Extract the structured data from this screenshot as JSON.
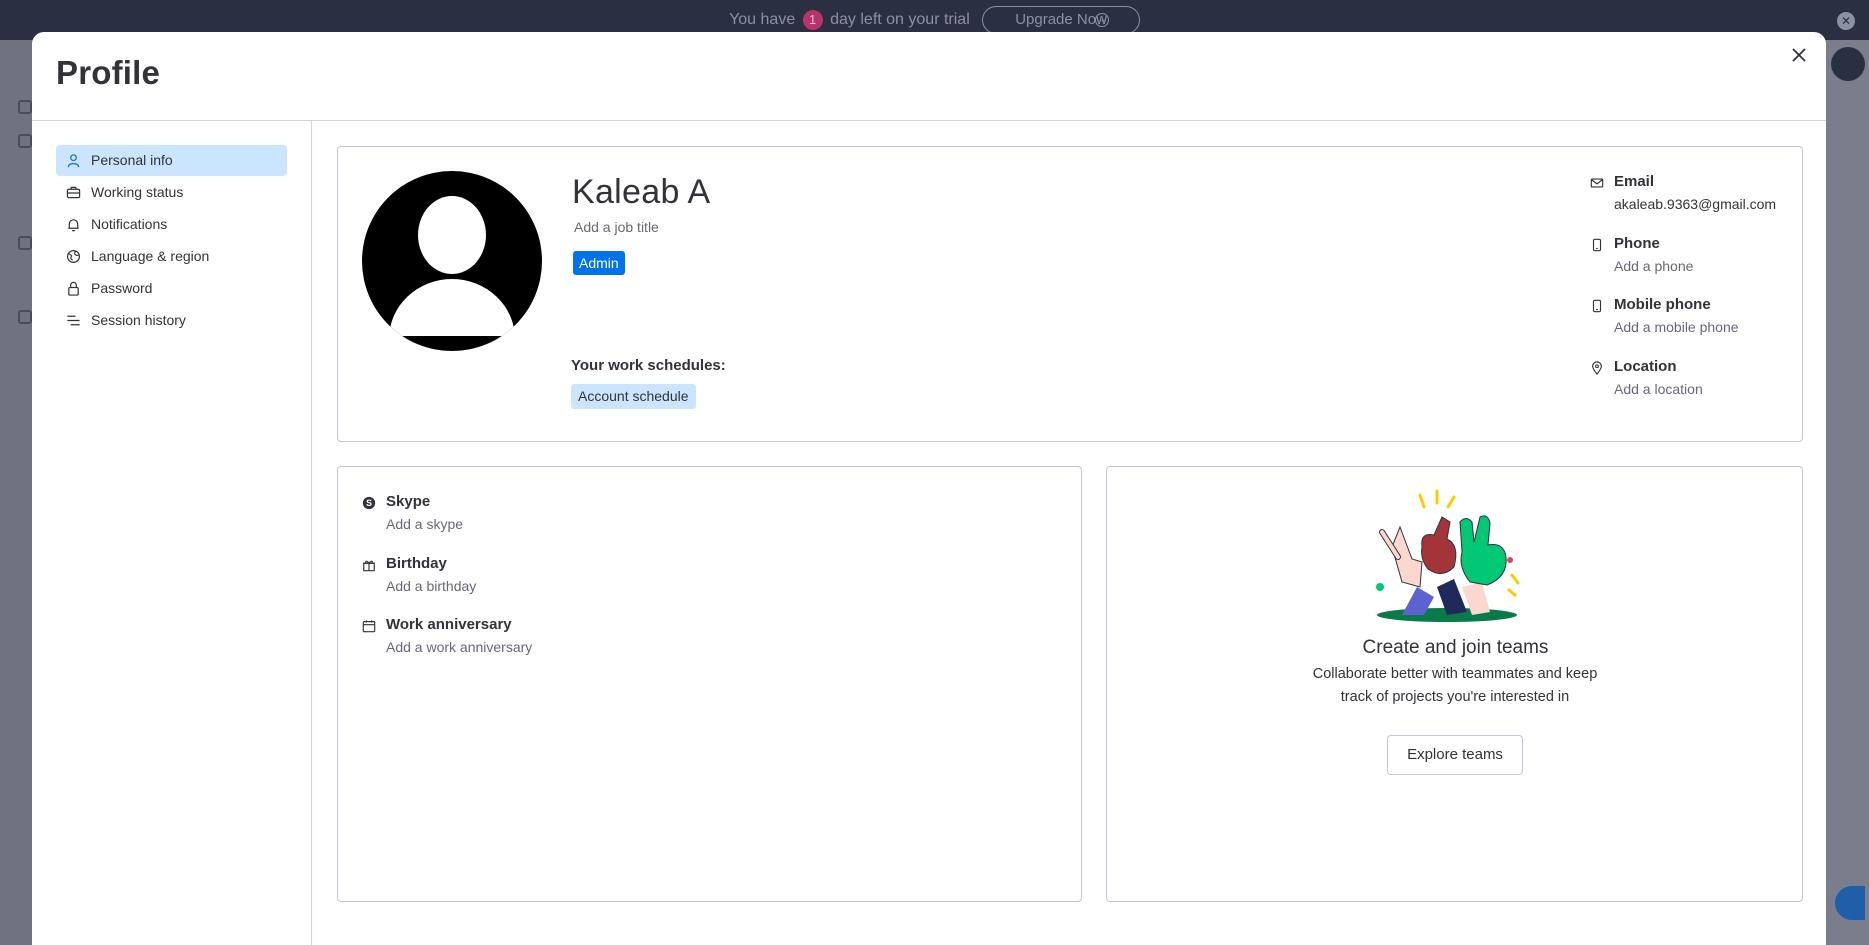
{
  "trial_banner": {
    "text_before": "You have",
    "days": "1",
    "text_after": "day left on your trial",
    "upgrade_label": "Upgrade Now"
  },
  "modal": {
    "title": "Profile",
    "close_icon": "close-icon"
  },
  "sidebar": {
    "items": [
      {
        "label": "Personal info",
        "icon": "person-icon",
        "active": true
      },
      {
        "label": "Working status",
        "icon": "briefcase-icon",
        "active": false
      },
      {
        "label": "Notifications",
        "icon": "bell-icon",
        "active": false
      },
      {
        "label": "Language & region",
        "icon": "globe-icon",
        "active": false
      },
      {
        "label": "Password",
        "icon": "lock-icon",
        "active": false
      },
      {
        "label": "Session history",
        "icon": "filter-lines-icon",
        "active": false
      }
    ]
  },
  "profile": {
    "name": "Kaleab A",
    "job_title_placeholder": "Add a job title",
    "role_badge": "Admin",
    "schedules_label": "Your work schedules:",
    "schedule_tag": "Account schedule"
  },
  "contact": {
    "email_label": "Email",
    "email_value": "akaleab.9363@gmail.com",
    "phone_label": "Phone",
    "phone_value": "Add a phone",
    "mobile_label": "Mobile phone",
    "mobile_value": "Add a mobile phone",
    "location_label": "Location",
    "location_value": "Add a location"
  },
  "extra": {
    "skype_label": "Skype",
    "skype_value": "Add a skype",
    "birthday_label": "Birthday",
    "birthday_value": "Add a birthday",
    "anniversary_label": "Work anniversary",
    "anniversary_value": "Add a work anniversary"
  },
  "teams": {
    "title": "Create and join teams",
    "subtitle": "Collaborate better with teammates and keep track of projects you're interested in",
    "button_label": "Explore teams"
  },
  "colors": {
    "accent": "#0073ea",
    "active_nav_bg": "#cce5ff",
    "topbar_bg": "#2b2f42"
  }
}
